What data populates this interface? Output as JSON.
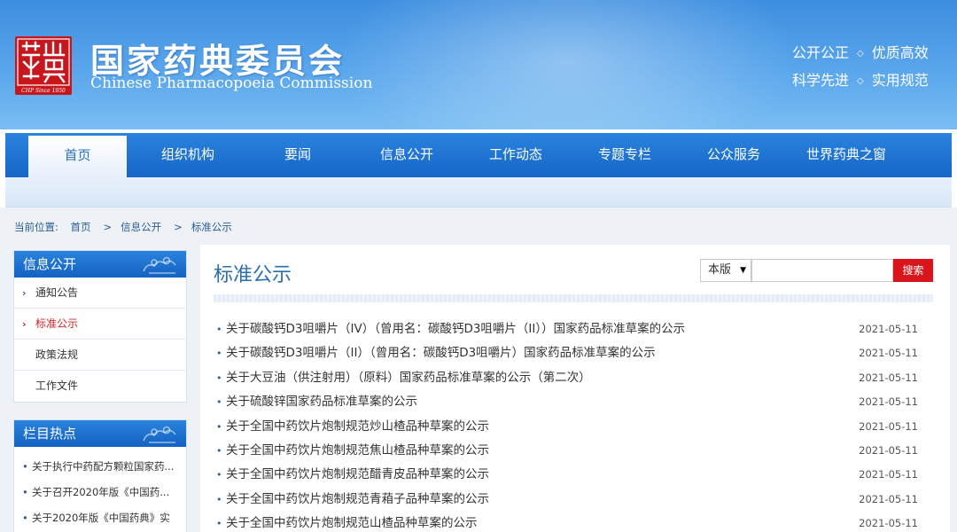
{
  "header": {
    "title": "国家药典委员会",
    "subtitle": "Chinese Pharmacopoeia Commission",
    "motto_row1": [
      "公开公正",
      "优质高效"
    ],
    "motto_row2": [
      "科学先进",
      "实用规范"
    ],
    "seal_text": "CHP Since 1950"
  },
  "nav": {
    "items": [
      "首页",
      "组织机构",
      "要闻",
      "信息公开",
      "工作动态",
      "专题专栏",
      "公众服务",
      "世界药典之窗"
    ],
    "active_index": 0
  },
  "breadcrumb": {
    "label": "当前位置:",
    "items": [
      "首页",
      "信息公开",
      "标准公示"
    ],
    "separator": ">"
  },
  "sidebar": {
    "info_title": "信息公开",
    "info_items": [
      "通知公告",
      "标准公示",
      "政策法规",
      "工作文件"
    ],
    "info_active_index": 1,
    "hot_title": "栏目热点",
    "hot_items": [
      "关于执行中药配方颗粒国家药...",
      "关于召开2020年版《中国药...",
      "关于2020年版《中国药典》实"
    ]
  },
  "main": {
    "title": "标准公示",
    "search_scope": "本版",
    "search_placeholder": "",
    "search_button": "搜索",
    "list": [
      {
        "title": "关于碳酸钙D3咀嚼片（IV）（曾用名：碳酸钙D3咀嚼片（II））国家药品标准草案的公示",
        "date": "2021-05-11"
      },
      {
        "title": "关于碳酸钙D3咀嚼片（II）（曾用名：碳酸钙D3咀嚼片）国家药品标准草案的公示",
        "date": "2021-05-11"
      },
      {
        "title": "关于大豆油（供注射用）（原料）国家药品标准草案的公示（第二次）",
        "date": "2021-05-11"
      },
      {
        "title": "关于硫酸锌国家药品标准草案的公示",
        "date": "2021-05-11"
      },
      {
        "title": "关于全国中药饮片炮制规范炒山楂品种草案的公示",
        "date": "2021-05-11"
      },
      {
        "title": "关于全国中药饮片炮制规范焦山楂品种草案的公示",
        "date": "2021-05-11"
      },
      {
        "title": "关于全国中药饮片炮制规范醋青皮品种草案的公示",
        "date": "2021-05-11"
      },
      {
        "title": "关于全国中药饮片炮制规范青葙子品种草案的公示",
        "date": "2021-05-11"
      },
      {
        "title": "关于全国中药饮片炮制规范山楂品种草案的公示",
        "date": "2021-05-11"
      }
    ]
  },
  "colors": {
    "nav_blue": "#1565c6",
    "accent_red": "#d9141a",
    "title_blue": "#2a6fb0"
  }
}
